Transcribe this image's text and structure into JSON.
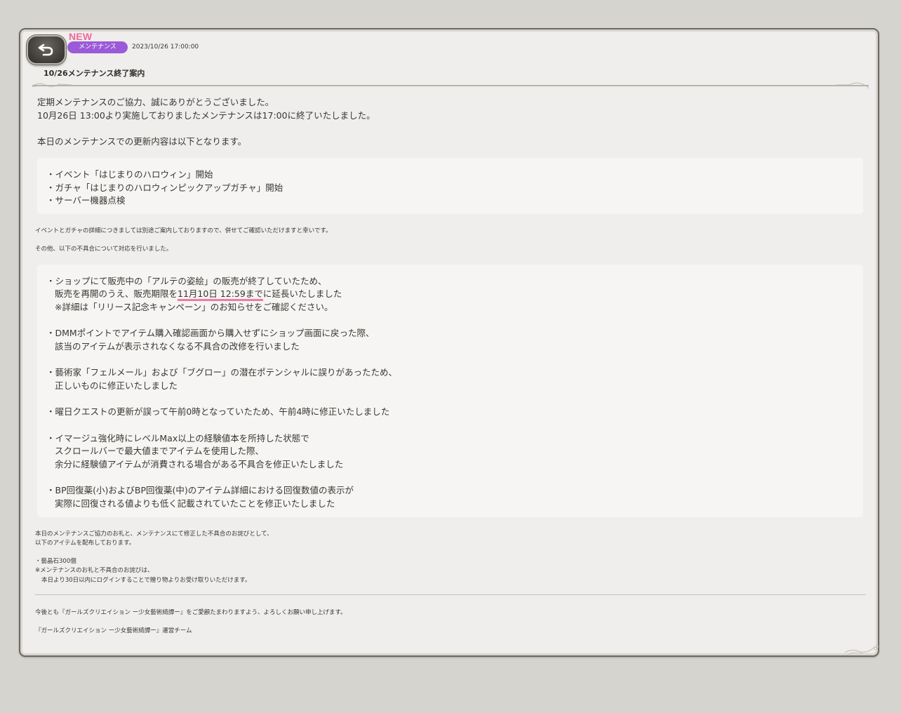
{
  "header": {
    "new_badge": "NEW",
    "category": "メンテナンス",
    "date": "2023/10/26 17:00:00",
    "title": "10/26メンテナンス終了案内"
  },
  "intro": {
    "line1": "定期メンテナンスのご協力、誠にありがとうございました。",
    "line2": "10月26日 13:00より実施しておりましたメンテナンスは17:00に終了いたしました。",
    "line3": "本日のメンテナンスでの更新内容は以下となります。"
  },
  "updates": [
    "・イベント「はじまりのハロウィン」開始",
    "・ガチャ「はじまりのハロウィンピックアップガチャ」開始",
    "・サーバー機器点検"
  ],
  "notes": {
    "details": "イベントとガチャの詳細につきましては別途ご案内しておりますので、併せてご確認いただけますと幸いです。",
    "fixes_intro": "その他、以下の不具合について対応を行いました。"
  },
  "fixes": {
    "f1_l1": "・ショップにて販売中の「アルテの姿絵」の販売が終了していたため、",
    "f1_l2_pre": "販売を再開のうえ、販売期限を",
    "f1_l2_hl": "11月10日 12:59まで",
    "f1_l2_post": "に延長いたしました",
    "f1_l3": "※詳細は「リリース記念キャンペーン」のお知らせをご確認ください。",
    "f2_l1": "・DMMポイントでアイテム購入確認画面から購入せずにショップ画面に戻った際、",
    "f2_l2": "該当のアイテムが表示されなくなる不具合の改修を行いました",
    "f3_l1": "・藝術家「フェルメール」および「ブグロー」の潜在ポテンシャルに誤りがあったため、",
    "f3_l2": "正しいものに修正いたしました",
    "f4_l1": "・曜日クエストの更新が誤って午前0時となっていたため、午前4時に修正いたしました",
    "f5_l1": "・イマージュ強化時にレベルMax以上の経験値本を所持した状態で",
    "f5_l2": "スクロールバーで最大値までアイテムを使用した際、",
    "f5_l3": "余分に経験値アイテムが消費される場合がある不具合を修正いたしました",
    "f6_l1": "・BP回復薬(小)およびBP回復薬(中)のアイテム詳細における回復数値の表示が",
    "f6_l2": "実際に回復される値よりも低く記載されていたことを修正いたしました"
  },
  "compensation": {
    "l1": "本日のメンテナンスご協力のお礼と、メンテナンスにて修正した不具合のお詫びとして、",
    "l2": "以下のアイテムを配布しております。",
    "item": "・藝晶石300個",
    "note1": "※メンテナンスのお礼と不具合のお詫びは、",
    "note2": "本日より30日以内にログインすることで贈り物よりお受け取りいただけます。"
  },
  "closing": {
    "l1": "今後とも『ガールズクリエイション ー少女藝術綺譚ー』をご愛顧たまわりますよう、よろしくお願い申し上げます。",
    "signature": "『ガールズクリエイション ー少女藝術綺譚ー』運営チーム"
  },
  "colors": {
    "accent_pill": "#9b5bd8",
    "new_badge": "#ef6a9a",
    "highlight": "#f07aa6"
  },
  "icons": {
    "back": "back-arrow-icon"
  }
}
